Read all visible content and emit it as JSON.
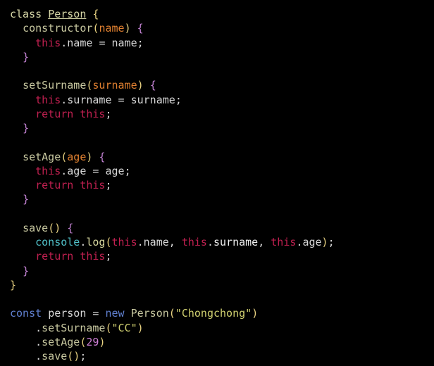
{
  "code": {
    "class_keyword": "class",
    "class_name": "Person",
    "constructor_name": "constructor",
    "constructor_param": "name",
    "this_keyword": "this",
    "return_keyword": "return",
    "const_keyword": "const",
    "new_keyword": "new",
    "prop_name": "name",
    "prop_surname": "surname",
    "prop_age": "age",
    "method_setSurname": "setSurname",
    "param_surname": "surname",
    "method_setAge": "setAge",
    "param_age": "age",
    "method_save": "save",
    "console": "console",
    "log": "log",
    "var_person": "person",
    "string_Chongchong": "\"Chongchong\"",
    "string_CC": "\"CC\"",
    "number_29": "29"
  }
}
